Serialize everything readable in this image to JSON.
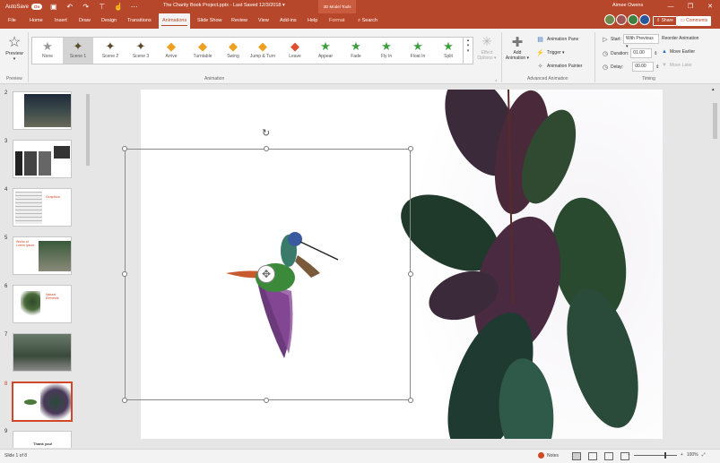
{
  "titlebar": {
    "autosave_label": "AutoSave",
    "autosave_state": "On",
    "document_title": "The Charity Book Project.pptx  -  Last Saved  12/3/2018  ▾",
    "context_tab": "3D Model Tools",
    "user_name": "Aimee Owens",
    "min": "—",
    "restore": "❐",
    "close": "✕"
  },
  "tabs": [
    "File",
    "Home",
    "Insert",
    "Draw",
    "Design",
    "Transitions",
    "Animations",
    "Slide Show",
    "Review",
    "View",
    "Add-ins",
    "Help",
    "Format"
  ],
  "active_tab": "Animations",
  "search_label": "Search",
  "share_label": "Share",
  "comments_label": "Comments",
  "avatar_colors": [
    "#6b8a4b",
    "#a05555",
    "#3f7f3f",
    "#2b579a"
  ],
  "ribbon": {
    "preview_label": "Preview",
    "preview_group": "Preview",
    "animation_group": "Animation",
    "advanced_group": "Advanced Animation",
    "timing_group": "Timing",
    "gallery": [
      {
        "label": "None",
        "icon": "★",
        "color": "#999999"
      },
      {
        "label": "Scene 1",
        "icon": "✦",
        "color": "#5a4a2a"
      },
      {
        "label": "Scene 2",
        "icon": "✦",
        "color": "#5a4a2a"
      },
      {
        "label": "Scene 3",
        "icon": "✦",
        "color": "#5a4a2a"
      },
      {
        "label": "Arrive",
        "icon": "◆",
        "color": "#f0a020"
      },
      {
        "label": "Turntable",
        "icon": "◆",
        "color": "#f0a020"
      },
      {
        "label": "Swing",
        "icon": "◆",
        "color": "#f0a020"
      },
      {
        "label": "Jump & Turn",
        "icon": "◆",
        "color": "#f0a020"
      },
      {
        "label": "Leave",
        "icon": "◆",
        "color": "#e05030"
      },
      {
        "label": "Appear",
        "icon": "★",
        "color": "#3f9f3f"
      },
      {
        "label": "Fade",
        "icon": "★",
        "color": "#3f9f3f"
      },
      {
        "label": "Fly In",
        "icon": "★",
        "color": "#3f9f3f"
      },
      {
        "label": "Float In",
        "icon": "★",
        "color": "#3f9f3f"
      },
      {
        "label": "Split",
        "icon": "★",
        "color": "#3f9f3f"
      }
    ],
    "selected_gallery": "Scene 1",
    "effect_options": "Effect\nOptions ▾",
    "add_animation": "Add\nAnimation ▾",
    "animation_pane": "Animation Pane",
    "trigger": "Trigger ▾",
    "animation_painter": "Animation Painter",
    "start_label": "Start:",
    "start_value": "With Previous",
    "duration_label": "Duration:",
    "duration_value": "01.00",
    "delay_label": "Delay:",
    "delay_value": "00.00",
    "reorder_label": "Reorder Animation",
    "move_earlier": "Move Earlier",
    "move_later": "Move Later"
  },
  "thumbnails": [
    {
      "num": "2"
    },
    {
      "num": "3"
    },
    {
      "num": "4",
      "text": "Graphics"
    },
    {
      "num": "5",
      "text": "Works of Lorem Ipsum"
    },
    {
      "num": "6",
      "text": "Natural Elements"
    },
    {
      "num": "7"
    },
    {
      "num": "8"
    },
    {
      "num": "9",
      "text": "Thank you!"
    }
  ],
  "status": {
    "slide_info": "Slide 1 of 8",
    "notes_label": "Notes",
    "zoom": "100%"
  },
  "colors": {
    "brand": "#b7472a",
    "accent": "#d24726"
  }
}
